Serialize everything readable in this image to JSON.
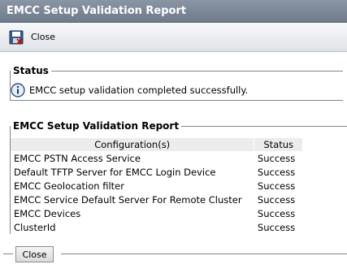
{
  "window": {
    "title": "EMCC Setup Validation Report"
  },
  "toolbar": {
    "close_label": "Close",
    "icon": "save-close-icon"
  },
  "status": {
    "legend": "Status",
    "message": "EMCC setup validation completed successfully.",
    "icon": "info-icon"
  },
  "report": {
    "legend": "EMCC Setup Validation Report",
    "columns": [
      "Configuration(s)",
      "Status"
    ],
    "rows": [
      {
        "config": "EMCC PSTN Access Service",
        "status": "Success"
      },
      {
        "config": "Default TFTP Server for EMCC Login Device",
        "status": "Success"
      },
      {
        "config": "EMCC Geolocation filter",
        "status": "Success"
      },
      {
        "config": "EMCC Service Default Server For Remote Cluster",
        "status": "Success"
      },
      {
        "config": "EMCC Devices",
        "status": "Success"
      },
      {
        "config": "ClusterId",
        "status": "Success"
      }
    ]
  },
  "footer": {
    "close_label": "Close"
  }
}
